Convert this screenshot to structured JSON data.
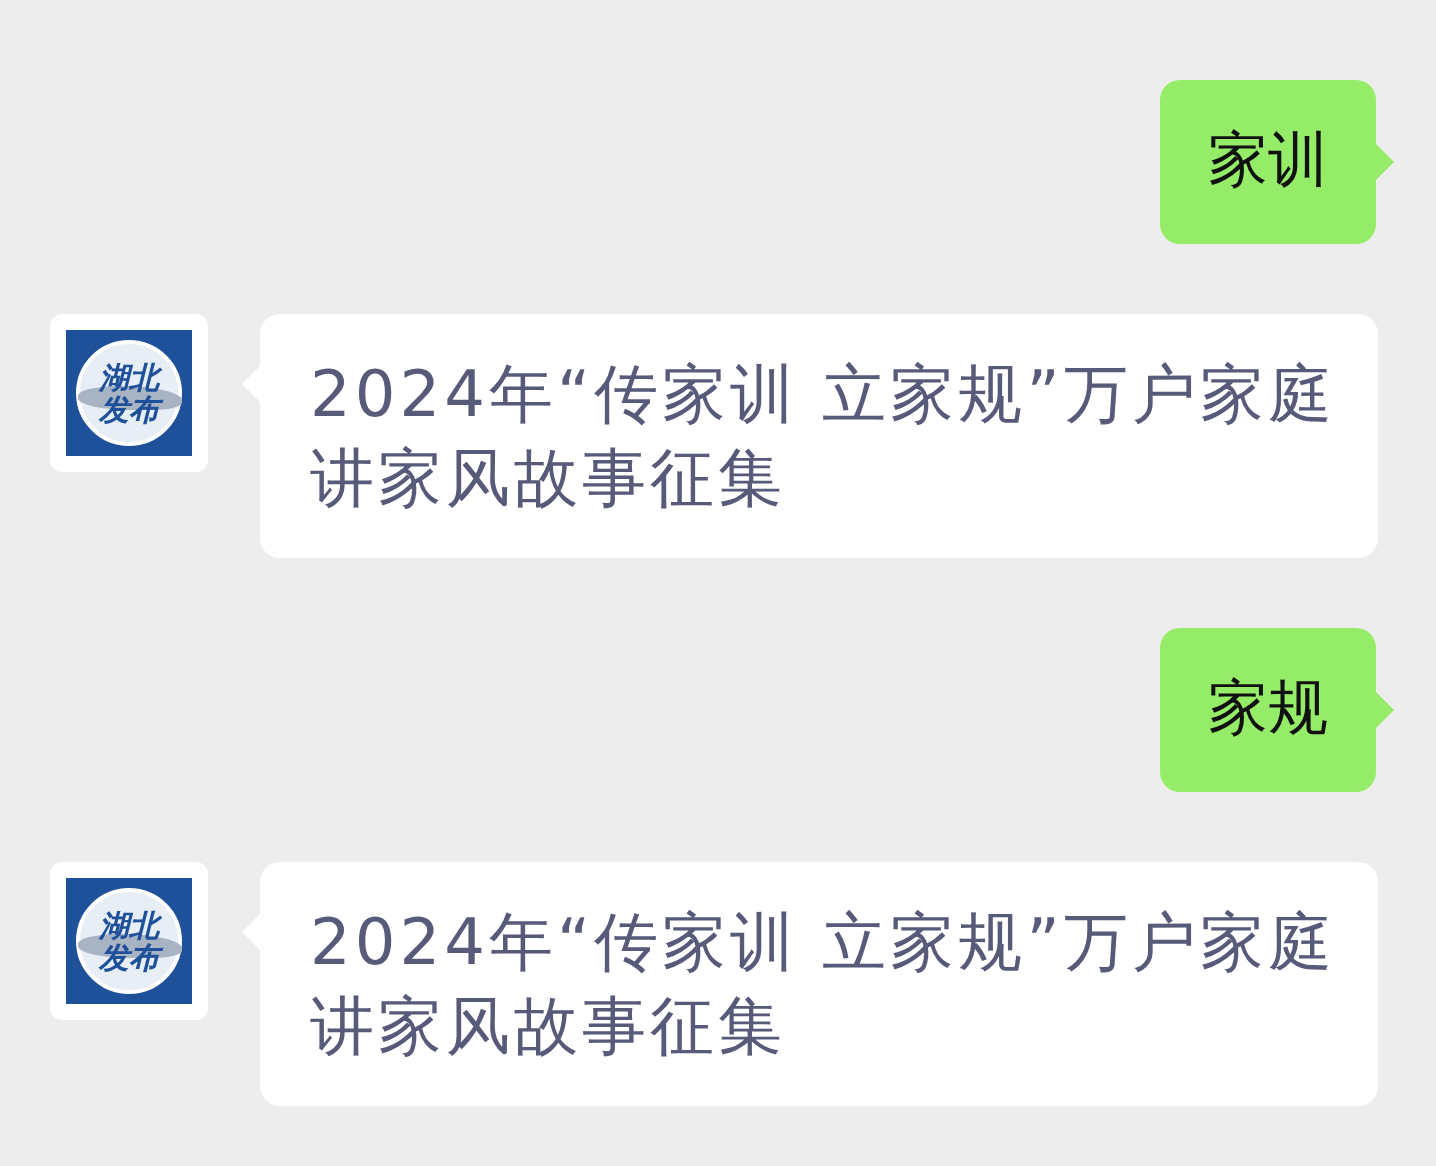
{
  "messages": [
    {
      "kind": "sent",
      "text": "家训"
    },
    {
      "kind": "received",
      "avatar": {
        "line_1": "湖北",
        "line_2": "发布"
      },
      "text": "2024年“传家训 立家规”万户家庭讲家风故事征集"
    },
    {
      "kind": "sent",
      "text": "家规"
    },
    {
      "kind": "received",
      "avatar": {
        "line_1": "湖北",
        "line_2": "发布"
      },
      "text": "2024年“传家训 立家规”万户家庭讲家风故事征集"
    }
  ]
}
